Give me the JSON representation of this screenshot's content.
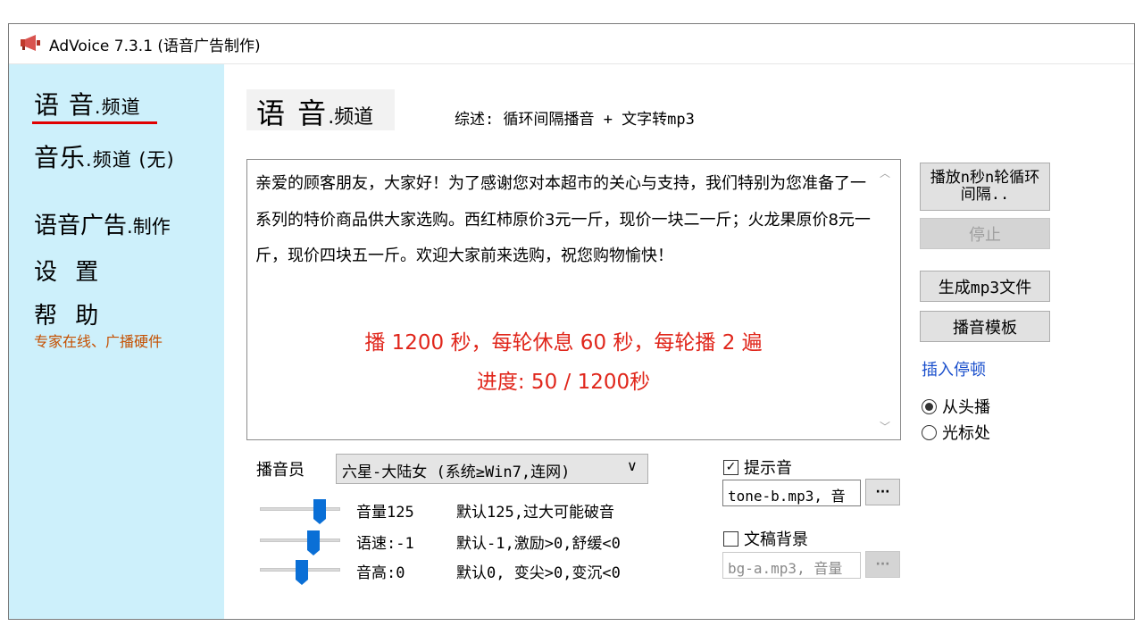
{
  "window": {
    "title": "AdVoice 7.3.1 (语音广告制作)",
    "logo_icon": "megaphone-icon"
  },
  "sidebar": {
    "voice_channel": {
      "main": "语 音",
      "suffix": ".频道"
    },
    "music_channel": {
      "main": "音乐",
      "suffix": ".频道 (无)"
    },
    "voice_ad": {
      "main": "语音广告",
      "suffix": ".制作"
    },
    "settings": "设 置",
    "help": "帮 助",
    "help_sub": "专家在线、广播硬件",
    "accent_color": "#e00000",
    "background_color": "#cdf0fb"
  },
  "main": {
    "heading": {
      "main": "语 音",
      "suffix": ".频道"
    },
    "summary": "综述:  循环间隔播音 + 文字转mp3",
    "script_text": "亲爱的顾客朋友，大家好！为了感谢您对本超市的关心与支持，我们特别为您准备了一系列的特价商品供大家选购。西红柿原价3元一斤，现价一块二一斤；火龙果原价8元一斤，现价四块五一斤。欢迎大家前来选购，祝您购物愉快！",
    "status_line1": "播 1200 秒，每轮休息 60 秒，每轮播 2 遍",
    "status_line2": "进度:  50 / 1200秒",
    "status_color": "#e0261b"
  },
  "right_panel": {
    "loop_button": "播放n秒n轮循环间隔..",
    "stop_button": "停止",
    "mp3_button": "生成mp3文件",
    "template_button": "播音模板",
    "insert_pause_link": "插入停顿",
    "radio_start": "从头播",
    "radio_cursor": "光标处",
    "radio_selected": "从头播"
  },
  "controls": {
    "announcer_label": "播音员",
    "announcer_value": "六星-大陆女 (系统≥Win7,连网)",
    "volume": {
      "label": "音量125",
      "hint": "默认125,过大可能破音",
      "level": 0.74
    },
    "speed": {
      "label": "语速:-1",
      "hint": "默认-1,激励>0,舒缓<0",
      "level": 0.67
    },
    "pitch": {
      "label": "音高:0",
      "hint": "默认0, 变尖>0,变沉<0",
      "level": 0.52
    },
    "prompt_tone": {
      "label": "提示音",
      "checked": true,
      "file": "tone-b.mp3, 音",
      "browse": "···"
    },
    "background": {
      "label": "文稿背景",
      "checked": false,
      "file": "bg-a.mp3, 音量",
      "browse": "···"
    }
  }
}
